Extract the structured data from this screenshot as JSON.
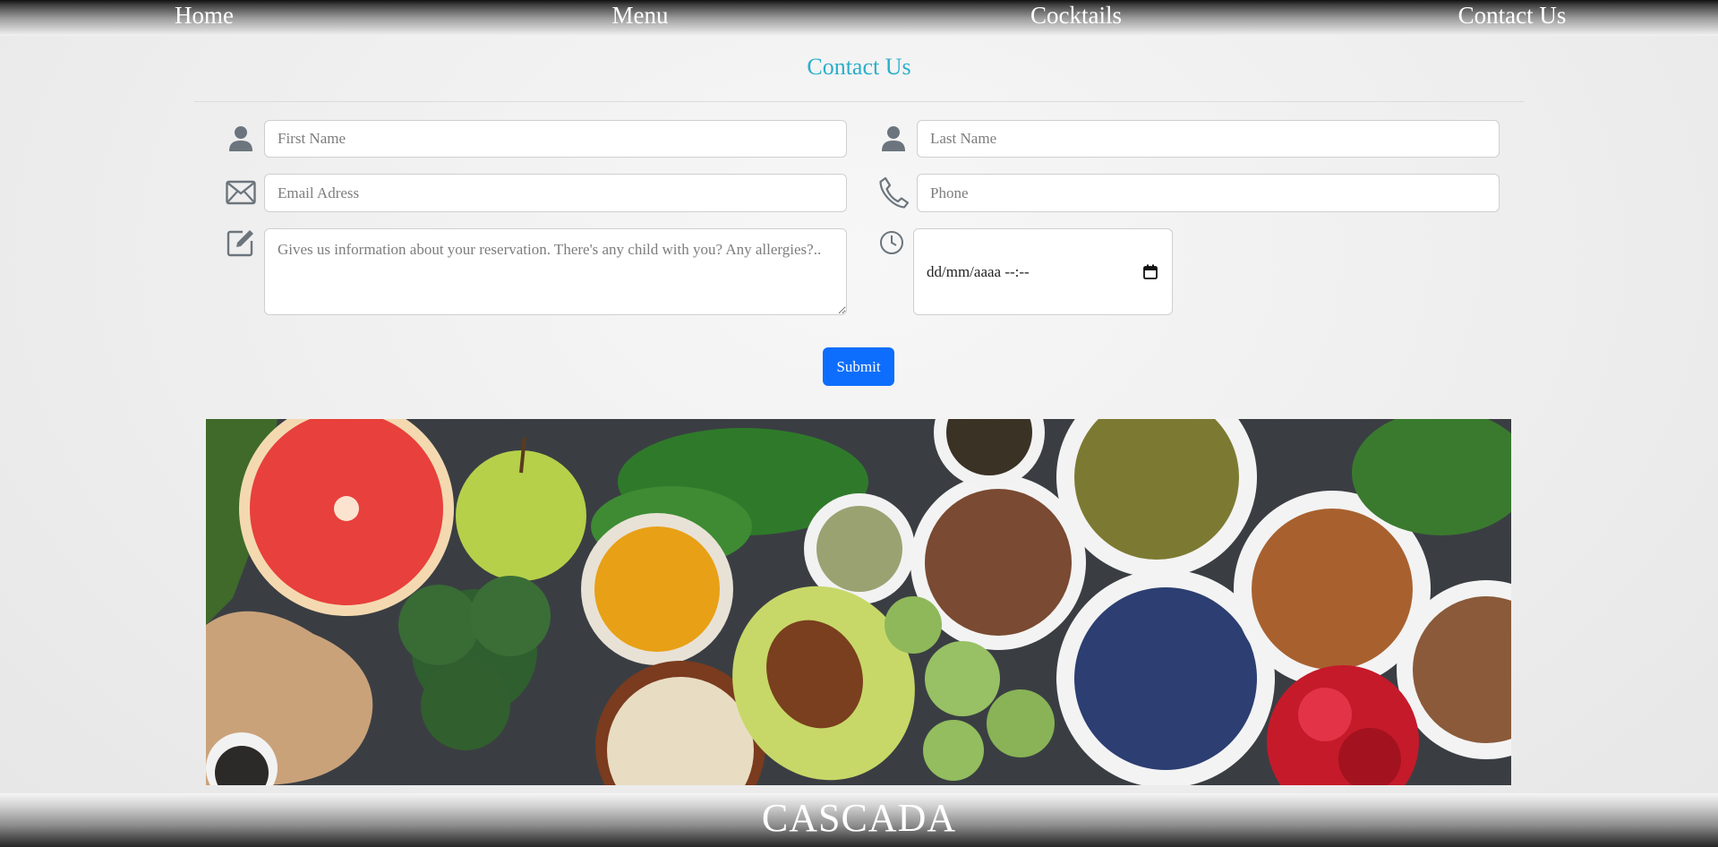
{
  "nav": {
    "home": "Home",
    "menu": "Menu",
    "cocktails": "Cocktails",
    "contact": "Contact Us"
  },
  "page": {
    "title": "Contact Us"
  },
  "form": {
    "first_name_placeholder": "First Name",
    "last_name_placeholder": "Last Name",
    "email_placeholder": "Email Adress",
    "phone_placeholder": "Phone",
    "message_placeholder": "Gives us information about your reservation. There's any child with you? Any allergies?..",
    "datetime_value": "dd/mm/aaaa --:--",
    "submit_label": "Submit"
  },
  "icons": {
    "first_name": "person-icon",
    "last_name": "person-icon",
    "email": "envelope-icon",
    "phone": "phone-icon",
    "message": "pencil-square-icon",
    "datetime": "clock-icon",
    "calendar": "calendar-icon"
  },
  "banner": {
    "subject": "photo of fresh vegetables, fruits, grains and spices in bowls"
  },
  "footer": {
    "brand": "CASCADA"
  },
  "colors": {
    "title": "#2aaecb",
    "submit": "#0d6efd",
    "icon": "#6c757d"
  }
}
